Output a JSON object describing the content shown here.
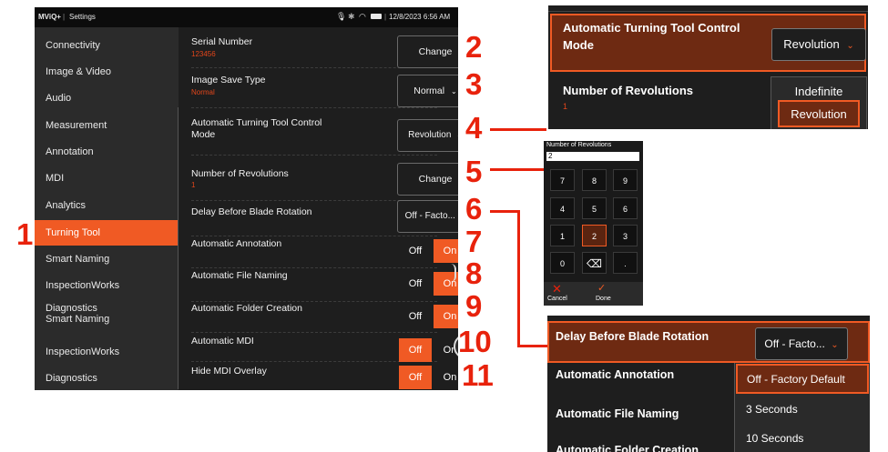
{
  "statusbar": {
    "app": "MViQ+",
    "separator": "|",
    "screen": "Settings",
    "datetime": "12/8/2023 6:56 AM"
  },
  "sidebar": {
    "items": [
      "Connectivity",
      "Image & Video",
      "Audio",
      "Measurement",
      "Annotation",
      "MDI",
      "Analytics",
      "Turning Tool",
      "Smart Naming",
      "InspectionWorks",
      "Diagnostics",
      "Smart Naming",
      "InspectionWorks",
      "Diagnostics"
    ],
    "selected": "Turning Tool"
  },
  "settings": {
    "serial": {
      "label": "Serial Number",
      "value": "123456",
      "button": "Change"
    },
    "image_save": {
      "label": "Image Save Type",
      "value": "Normal",
      "selected": "Normal"
    },
    "auto_turning": {
      "label": "Automatic Turning Tool Control Mode",
      "selected": "Revolution"
    },
    "revolutions": {
      "label": "Number of Revolutions",
      "value": "1",
      "button": "Change"
    },
    "delay": {
      "label": "Delay Before Blade Rotation",
      "selected": "Off - Facto..."
    },
    "auto_annotation": {
      "label": "Automatic Annotation",
      "off": "Off",
      "on": "On",
      "state": "On"
    },
    "auto_file_naming": {
      "label": "Automatic File Naming",
      "off": "Off",
      "on": "On",
      "state": "On"
    },
    "auto_folder": {
      "label": "Automatic Folder Creation",
      "off": "Off",
      "on": "On",
      "state": "On"
    },
    "auto_mdi": {
      "label": "Automatic MDI",
      "off": "Off",
      "on": "On",
      "state": "Off"
    },
    "hide_mdi": {
      "label": "Hide MDI Overlay",
      "off": "Off",
      "on": "On",
      "state": "Off"
    }
  },
  "callouts": [
    "1",
    "2",
    "3",
    "4",
    "5",
    "6",
    "7",
    "8",
    "9",
    "10",
    "11"
  ],
  "zoom_turning": {
    "label": "Automatic Turning Tool Control Mode",
    "selected": "Revolution",
    "options": [
      "Indefinite",
      "Revolution"
    ],
    "next_label": "Number of Revolutions",
    "next_value": "1"
  },
  "keypad": {
    "title": "Number of Revolutions",
    "value": "2",
    "keys": [
      "7",
      "8",
      "9",
      "4",
      "5",
      "6",
      "1",
      "2",
      "3",
      "0",
      "⌫",
      "."
    ],
    "cancel": "Cancel",
    "done": "Done"
  },
  "zoom_delay": {
    "label": "Delay Before Blade Rotation",
    "selected": "Off - Facto...",
    "options": [
      "Off - Factory Default",
      "3 Seconds",
      "10 Seconds"
    ],
    "rows": [
      "Automatic Annotation",
      "Automatic File Naming",
      "Automatic Folder Creation"
    ]
  },
  "colors": {
    "accent": "#f05a24",
    "callout": "#e8220c",
    "background": "#1e1e1e",
    "sidebar": "#2b2b2b"
  }
}
